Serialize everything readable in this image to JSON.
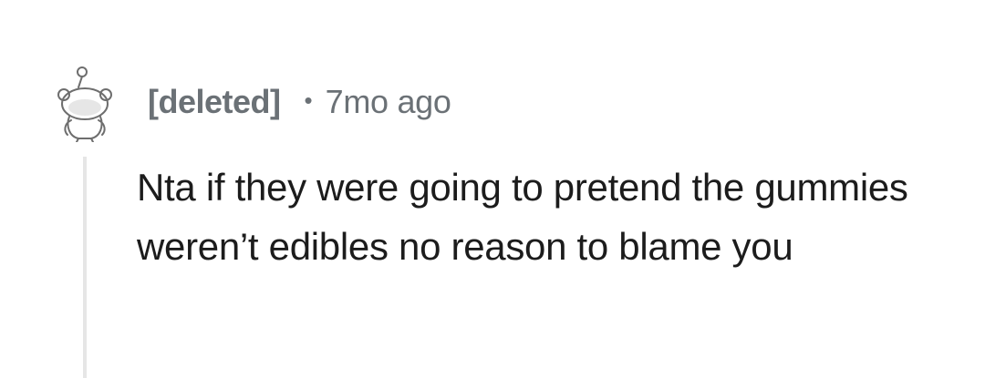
{
  "comment": {
    "author": "[deleted]",
    "separator": "•",
    "timestamp": "7mo ago",
    "body": "Nta if they were going to pretend the gummies weren’t edibles no reason to blame you",
    "avatar_icon": "snoo-avatar-icon"
  },
  "colors": {
    "meta_text": "#6b7176",
    "body_text": "#1c1c1c",
    "thread_line": "#e6e6e6",
    "background": "#ffffff"
  }
}
